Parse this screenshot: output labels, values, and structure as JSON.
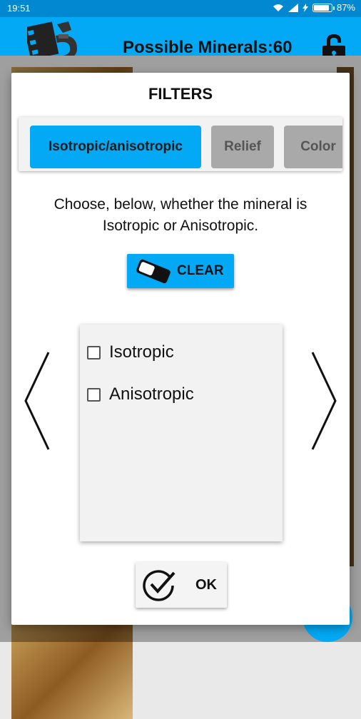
{
  "status_bar": {
    "time": "19:51",
    "battery": "87%",
    "battery_level": 0.87
  },
  "app_bar": {
    "title": "Possible Minerals:60",
    "logo_icon": "microscope-logo-icon",
    "lock_icon": "lock-icon"
  },
  "dialog": {
    "title": "FILTERS",
    "tabs": [
      {
        "label": "Isotropic/anisotropic",
        "active": true
      },
      {
        "label": "Relief",
        "active": false
      },
      {
        "label": "Color",
        "active": false
      }
    ],
    "description": "Choose, below, whether the mineral is Isotropic or Anisotropic.",
    "clear_label": "CLEAR",
    "options": [
      {
        "label": "Isotropic",
        "checked": false
      },
      {
        "label": "Anisotropic",
        "checked": false
      }
    ],
    "ok_label": "OK"
  },
  "colors": {
    "accent": "#03a9f4",
    "status_bar": "#0288d1",
    "tab_inactive": "#a9a9a9"
  }
}
